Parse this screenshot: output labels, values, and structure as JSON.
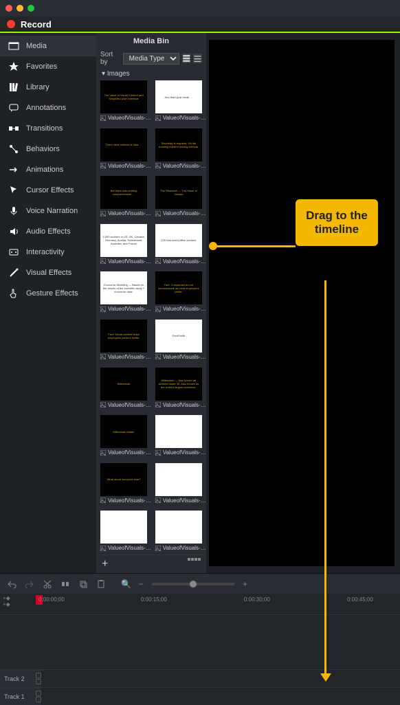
{
  "titlebar": {},
  "recorder": {
    "label": "Record"
  },
  "sidebar": {
    "items": [
      {
        "label": "Media",
        "icon": "media-icon"
      },
      {
        "label": "Favorites",
        "icon": "star-icon"
      },
      {
        "label": "Library",
        "icon": "library-icon"
      },
      {
        "label": "Annotations",
        "icon": "annotations-icon"
      },
      {
        "label": "Transitions",
        "icon": "transitions-icon"
      },
      {
        "label": "Behaviors",
        "icon": "behaviors-icon"
      },
      {
        "label": "Animations",
        "icon": "animations-icon"
      },
      {
        "label": "Cursor Effects",
        "icon": "cursor-icon"
      },
      {
        "label": "Voice Narration",
        "icon": "mic-icon"
      },
      {
        "label": "Audio Effects",
        "icon": "speaker-icon"
      },
      {
        "label": "Interactivity",
        "icon": "interactivity-icon"
      },
      {
        "label": "Visual Effects",
        "icon": "wand-icon"
      },
      {
        "label": "Gesture Effects",
        "icon": "gesture-icon"
      }
    ]
  },
  "mediabin": {
    "title": "Media Bin",
    "sort_label": "Sort by",
    "sort_value": "Media Type",
    "category": "Images",
    "items": [
      {
        "name": "ValueofVisuals-…",
        "theme": "dark",
        "text": "The Value of Visual Content and Simplified User Interface"
      },
      {
        "name": "ValueofVisuals-…",
        "theme": "light",
        "text": "And that's just email …"
      },
      {
        "name": "ValueofVisuals-…",
        "theme": "dark",
        "text": "There were millions of data …"
      },
      {
        "name": "ValueofVisuals-…",
        "theme": "dark",
        "text": "Simplicity is required. It's the existing problem solving formula."
      },
      {
        "name": "ValueofVisuals-…",
        "theme": "dark",
        "text": "But there was nothing comprehensive …"
      },
      {
        "name": "ValueofVisuals-…",
        "theme": "dark",
        "text": "The Research — The Value of Visuals"
      },
      {
        "name": "ValueofVisuals-…",
        "theme": "light",
        "text": "4,500 workers in US, UK, Canada, Germany, Austria, Switzerland, Australia, and France"
      },
      {
        "name": "ValueofVisuals-…",
        "theme": "light",
        "text": "125 real-world office workers"
      },
      {
        "name": "ValueofVisuals-…",
        "theme": "light",
        "text": "Economic Modeling — Based on the results of the scientific study + economic data."
      },
      {
        "name": "ValueofVisuals-…",
        "theme": "dark",
        "text": "Fact: Companies do not communicate as most employees prefer."
      },
      {
        "name": "ValueofVisuals-…",
        "theme": "dark",
        "text": "Fact: Visual content helps employees perform better."
      },
      {
        "name": "ValueofVisuals-…",
        "theme": "light",
        "text": "TechSmith"
      },
      {
        "name": "ValueofVisuals-…",
        "theme": "dark",
        "text": "Millennials"
      },
      {
        "name": "ValueofVisuals-…",
        "theme": "dark",
        "text": "Millennials — Also known as workers under 35. Also known as the world's largest workforce."
      },
      {
        "name": "ValueofVisuals-…",
        "theme": "dark",
        "text": "Millennials Matter"
      },
      {
        "name": "ValueofVisuals-…",
        "theme": "light",
        "text": ""
      },
      {
        "name": "ValueofVisuals-…",
        "theme": "dark",
        "text": "What about everyone else?"
      },
      {
        "name": "ValueofVisuals-…",
        "theme": "light",
        "text": ""
      },
      {
        "name": "ValueofVisuals-…",
        "theme": "light",
        "text": ""
      },
      {
        "name": "ValueofVisuals-…",
        "theme": "light",
        "text": ""
      }
    ]
  },
  "timeline": {
    "ticks": [
      "0:00:00;00",
      "0:00:15;00",
      "0:00:30;00",
      "0:00:45;00"
    ],
    "tracks": [
      "Track 2",
      "Track 1"
    ]
  },
  "callout": {
    "text": "Drag to the timeline"
  }
}
